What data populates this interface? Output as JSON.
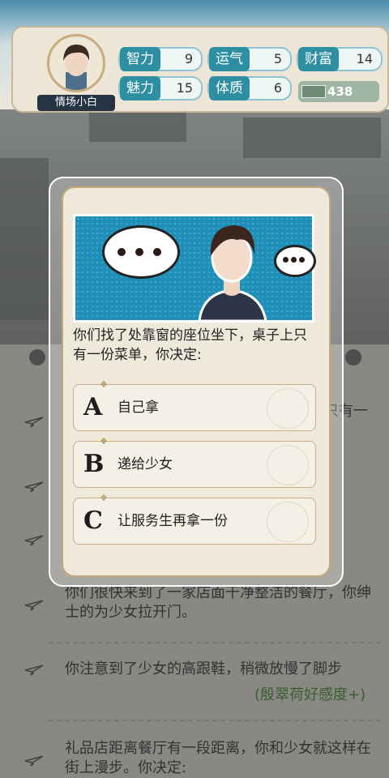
{
  "header": {
    "player_name": "情场小白",
    "stats": [
      {
        "label": "智力",
        "value": "9"
      },
      {
        "label": "运气",
        "value": "5"
      },
      {
        "label": "财富",
        "value": "14"
      },
      {
        "label": "魅力",
        "value": "15"
      },
      {
        "label": "体质",
        "value": "6"
      }
    ],
    "money": "438"
  },
  "modal": {
    "question": "你们找了处靠窗的座位坐下，桌子上只有一份菜单，你决定:",
    "options": [
      {
        "letter": "A",
        "text": "自己拿"
      },
      {
        "letter": "B",
        "text": "递给少女"
      },
      {
        "letter": "C",
        "text": "让服务生再拿一份"
      }
    ]
  },
  "story": {
    "partial_right": "只有一",
    "lines": [
      "你们很快来到了一家店面干净整洁的餐厅，你绅士的为少女拉开门。",
      "你注意到了少女的高跟鞋，稍微放慢了脚步",
      "(殷翠荷好感度+)",
      "礼品店距离餐厅有一段距离，你和少女就这样在街上漫步。你决定:"
    ]
  },
  "colors": {
    "stat_label": "#2e8fa3",
    "banner": "#1f8fb8",
    "affection": "#4a8a3a"
  }
}
